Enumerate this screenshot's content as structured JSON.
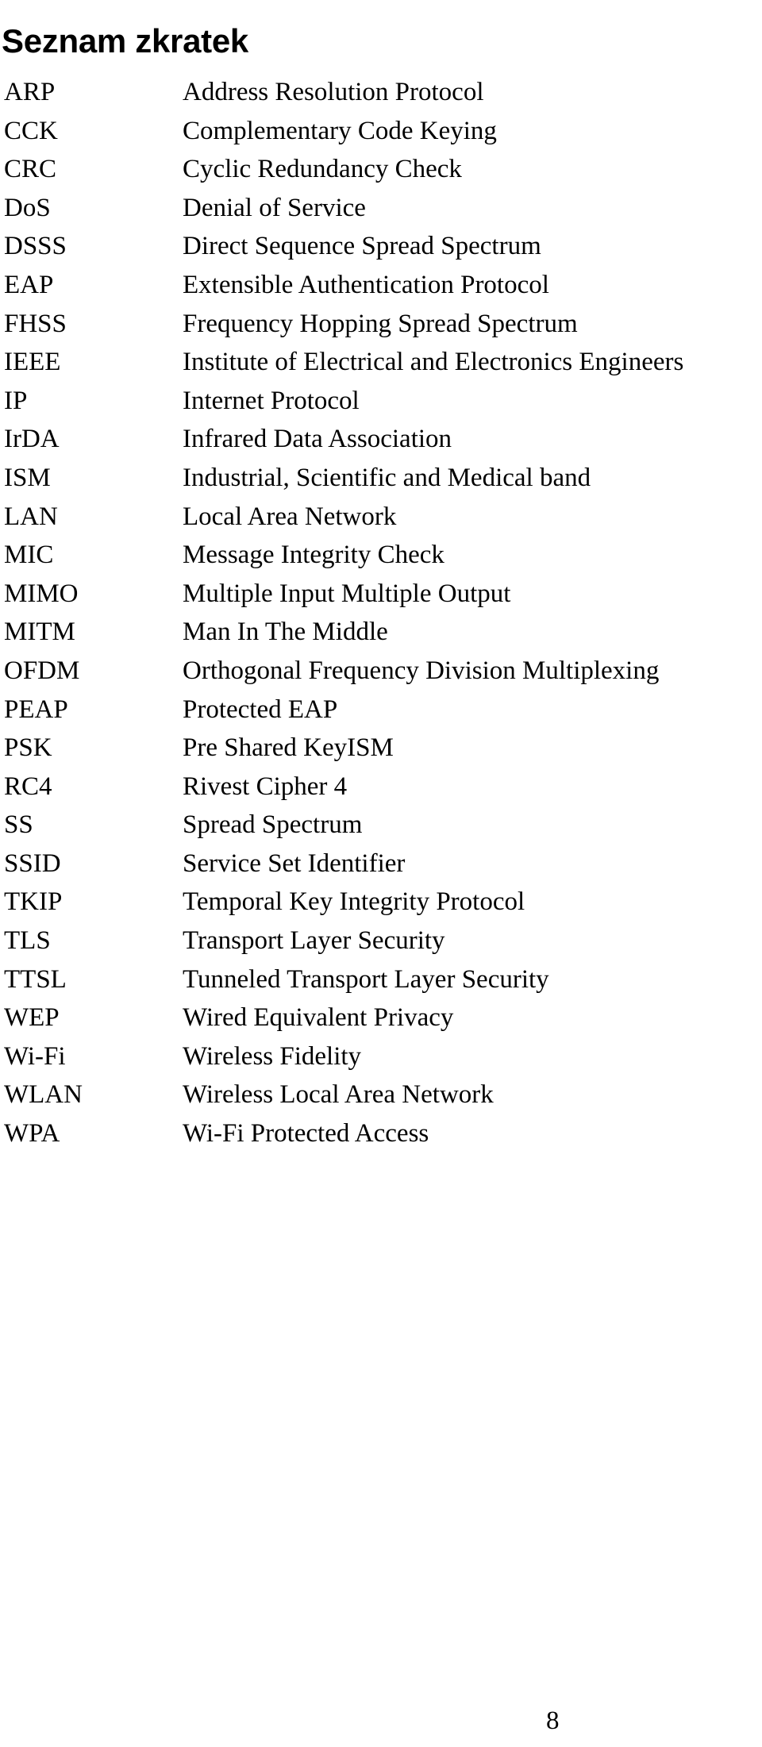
{
  "document": {
    "title": "Seznam zkratek",
    "page_number": "8",
    "text_color": "#000000",
    "background_color": "#ffffff"
  },
  "abbreviations": [
    {
      "term": "ARP",
      "definition": "Address Resolution Protocol"
    },
    {
      "term": "CCK",
      "definition": "Complementary Code Keying"
    },
    {
      "term": "CRC",
      "definition": "Cyclic Redundancy Check"
    },
    {
      "term": "DoS",
      "definition": "Denial of Service"
    },
    {
      "term": "DSSS",
      "definition": "Direct Sequence Spread Spectrum"
    },
    {
      "term": "EAP",
      "definition": "Extensible Authentication Protocol"
    },
    {
      "term": "FHSS",
      "definition": "Frequency Hopping Spread Spectrum"
    },
    {
      "term": "IEEE",
      "definition": "Institute of Electrical and Electronics Engineers"
    },
    {
      "term": "IP",
      "definition": "Internet Protocol"
    },
    {
      "term": "IrDA",
      "definition": "Infrared Data Association"
    },
    {
      "term": "ISM",
      "definition": "Industrial, Scientific and Medical band"
    },
    {
      "term": "LAN",
      "definition": "Local Area Network"
    },
    {
      "term": "MIC",
      "definition": "Message Integrity Check"
    },
    {
      "term": "MIMO",
      "definition": "Multiple Input Multiple Output"
    },
    {
      "term": "MITM",
      "definition": "Man In The Middle"
    },
    {
      "term": "OFDM",
      "definition": "Orthogonal Frequency Division Multiplexing"
    },
    {
      "term": "PEAP",
      "definition": "Protected EAP"
    },
    {
      "term": "PSK",
      "definition": "Pre Shared KeyISM"
    },
    {
      "term": "RC4",
      "definition": "Rivest Cipher 4"
    },
    {
      "term": "SS",
      "definition": "Spread Spectrum"
    },
    {
      "term": "SSID",
      "definition": "Service Set Identifier"
    },
    {
      "term": "TKIP",
      "definition": "Temporal Key Integrity Protocol"
    },
    {
      "term": "TLS",
      "definition": "Transport Layer Security"
    },
    {
      "term": "TTSL",
      "definition": "Tunneled Transport Layer Security"
    },
    {
      "term": "WEP",
      "definition": "Wired Equivalent Privacy"
    },
    {
      "term": "Wi-Fi",
      "definition": "Wireless Fidelity"
    },
    {
      "term": "WLAN",
      "definition": "Wireless Local Area Network"
    },
    {
      "term": "WPA",
      "definition": "Wi-Fi Protected Access"
    }
  ]
}
